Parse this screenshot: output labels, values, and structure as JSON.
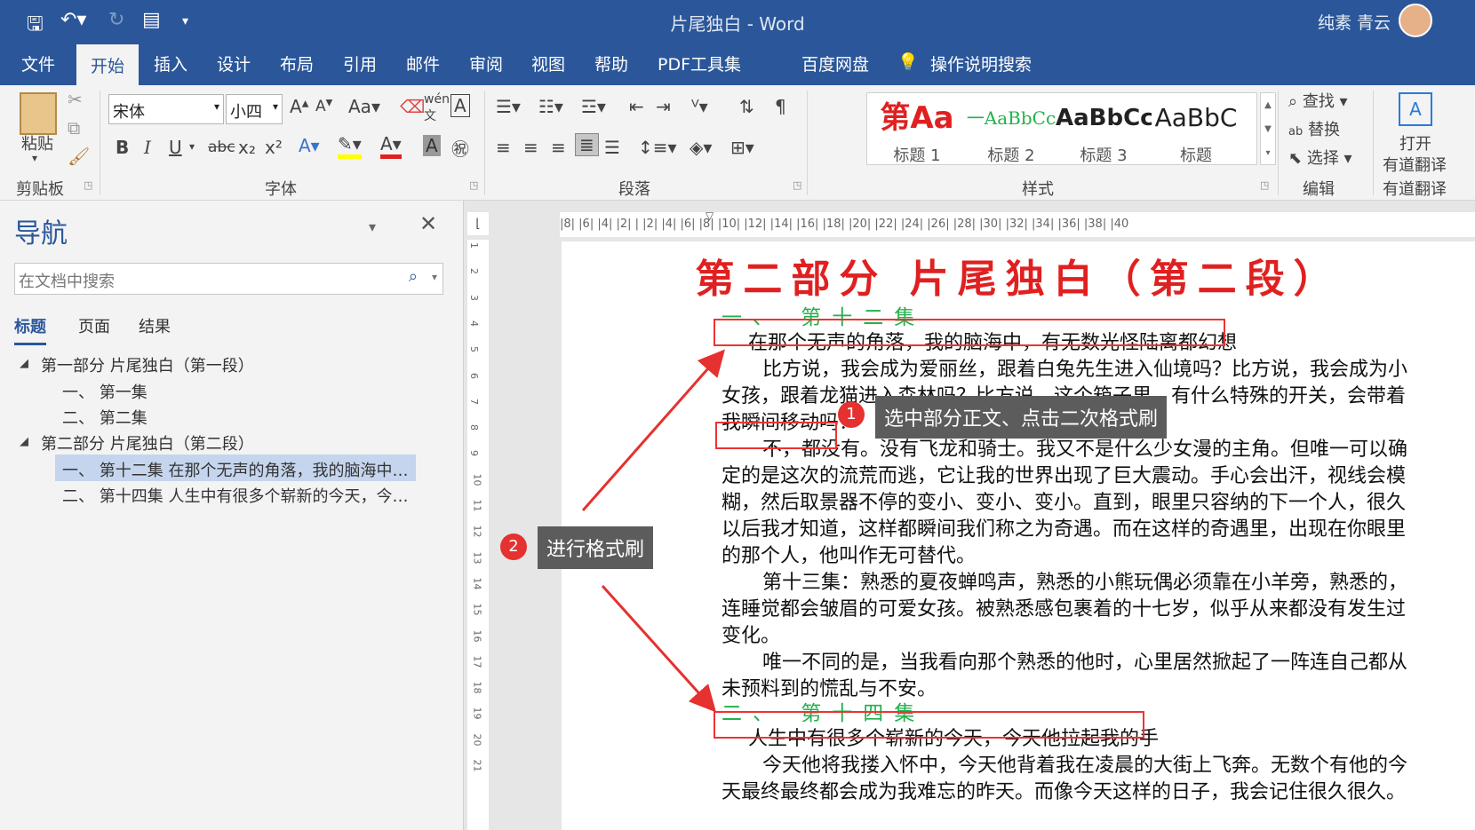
{
  "title_bar": {
    "doc_title": "片尾独白",
    "separator": "-",
    "app_name": "Word",
    "user": "纯素 青云"
  },
  "tabs": [
    "文件",
    "开始",
    "插入",
    "设计",
    "布局",
    "引用",
    "邮件",
    "审阅",
    "视图",
    "帮助",
    "PDF工具集",
    "百度网盘",
    "操作说明搜索"
  ],
  "ribbon": {
    "clipboard": {
      "paste": "粘贴",
      "label": "剪贴板"
    },
    "font": {
      "name": "宋体",
      "size": "小四",
      "label": "字体",
      "bold": "B",
      "italic": "I",
      "underline": "U",
      "strike": "abc",
      "sub": "x₂",
      "sup": "x²",
      "case": "Aa",
      "grow": "A",
      "shrink": "A"
    },
    "paragraph": {
      "label": "段落"
    },
    "styles": {
      "label": "样式",
      "items": [
        {
          "preview": "第Aa",
          "name": "标题 1"
        },
        {
          "preview": "一AaBbCc",
          "name": "标题 2"
        },
        {
          "preview": "AaBbCc",
          "name": "标题 3"
        },
        {
          "preview": "AaBbC",
          "name": "标题"
        }
      ]
    },
    "editing": {
      "find": "查找",
      "replace": "替换",
      "select": "选择",
      "label": "编辑"
    },
    "youdao": {
      "open": "打开",
      "translate": "有道翻译",
      "label": "有道翻译"
    }
  },
  "nav": {
    "title": "导航",
    "search_placeholder": "在文档中搜索",
    "tabs": [
      "标题",
      "页面",
      "结果"
    ],
    "items": [
      "第一部分 片尾独白（第一段）",
      "一、 第一集",
      "二、 第二集",
      "第二部分 片尾独白（第二段）",
      "一、 第十二集 在那个无声的角落，我的脑海中，…",
      "二、 第十四集 人生中有很多个崭新的今天，今天…"
    ]
  },
  "ruler": {
    "h": "|8|  |6|  |4|  |2|  |  |2|  |4|  |6|  |8|  |10|  |12|  |14|  |16|  |18|  |20|  |22|  |24|  |26|  |28|  |30|  |32|  |34|  |36|  |38|  |40",
    "v": [
      "1",
      "2",
      "3",
      "4",
      "5",
      "6",
      "7",
      "8",
      "9",
      "10",
      "11",
      "12",
      "13",
      "14",
      "15",
      "16",
      "17",
      "18",
      "19",
      "20",
      "21"
    ]
  },
  "document": {
    "title": "第二部分 片尾独白（第二段）",
    "h_12": "一、 第十二集",
    "lines": [
      "在那个无声的角落，我的脑海中，有无数光怪陆离都幻想",
      "比方说，我会成为爱丽丝，跟着白兔先生进入仙境吗？比方说，我会成为小",
      "女孩，跟着龙猫进入森林吗？比方说，这个箱子里，有什么特殊的开关，会带着",
      "我瞬间移动吗？",
      "不，都没有。没有飞龙和骑士。我又不是什么少女漫的主角。但唯一可以确",
      "定的是这次的流荒而逃，它让我的世界出现了巨大震动。手心会出汗，视线会模",
      "糊，然后取景器不停的变小、变小、变小。直到，眼里只容纳的下一个人，很久",
      "以后我才知道，这样都瞬间我们称之为奇遇。而在这样的奇遇里，出现在你眼里",
      "的那个人，他叫作无可替代。",
      "第十三集：熟悉的夏夜蝉鸣声，熟悉的小熊玩偶必须靠在小羊旁，熟悉的，",
      "连睡觉都会皱眉的可爱女孩。被熟悉感包裹着的十七岁，似乎从来都没有发生过",
      "变化。",
      "唯一不同的是，当我看向那个熟悉的他时，心里居然掀起了一阵连自己都从",
      "未预料到的慌乱与不安。"
    ],
    "h_14": "二、 第十四集",
    "lines2": [
      "人生中有很多个崭新的今天，今天他拉起我的手",
      "今天他将我搂入怀中，今天他背着我在凌晨的大街上飞奔。无数个有他的今",
      "天最终最终都会成为我难忘的昨天。而像今天这样的日子，我会记住很久很久。"
    ]
  },
  "annotations": {
    "step1_num": "1",
    "step1_text": "选中部分正文、点击二次格式刷",
    "step2_num": "2",
    "step2_text": "进行格式刷"
  },
  "colors": {
    "brand": "#2b579a",
    "title_red": "#e02020",
    "heading_green": "#22b14c",
    "annotation_red": "#e5312f"
  }
}
